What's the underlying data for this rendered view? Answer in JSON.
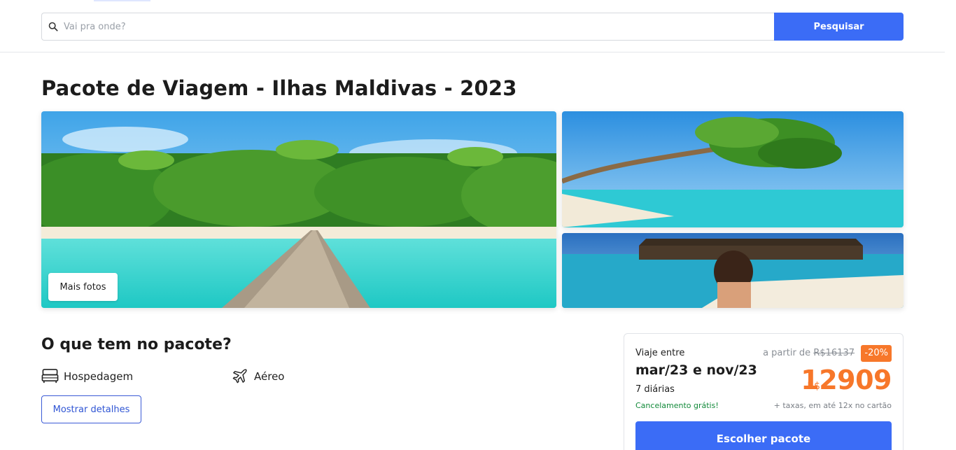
{
  "search": {
    "placeholder": "Vai pra onde?",
    "button_label": "Pesquisar"
  },
  "page_title": "Pacote de Viagem - Ilhas Maldivas - 2023",
  "gallery": {
    "more_photos_label": "Mais fotos"
  },
  "package": {
    "section_title": "O que tem no pacote?",
    "features": [
      {
        "label": "Hospedagem",
        "icon": "bed-icon"
      },
      {
        "label": "Aéreo",
        "icon": "airplane-icon"
      }
    ],
    "details_button_label": "Mostrar detalhes"
  },
  "price_card": {
    "travel_label": "Viaje entre",
    "travel_dates": "mar/23 e nov/23",
    "nights": "7 diárias",
    "cancellation": "Cancelamento grátis!",
    "from_label": "a partir de",
    "old_price": "R$16137",
    "discount": "-20%",
    "currency": "R$",
    "price": "12909",
    "price_note": "+ taxas, em até 12x no cartão",
    "choose_button_label": "Escolher pacote"
  },
  "colors": {
    "primary": "#3b6cf6",
    "accent_orange": "#f7772a",
    "success_green": "#128a3a"
  }
}
